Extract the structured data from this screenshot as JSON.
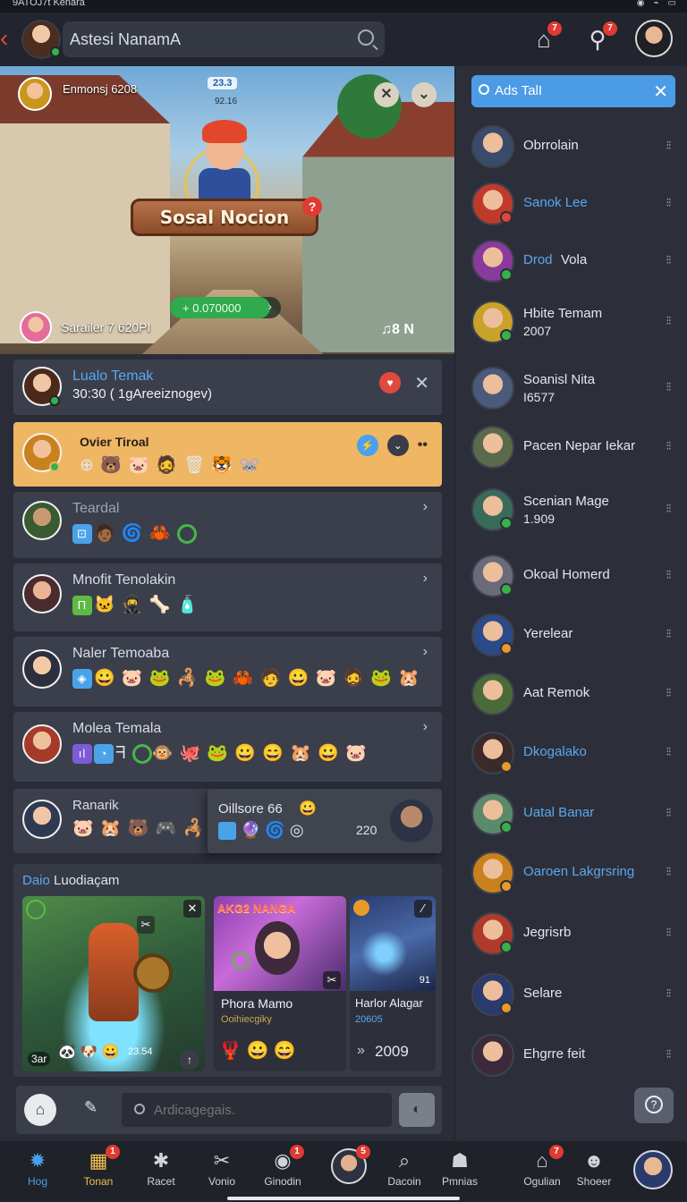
{
  "status_bar": {
    "text": "9ATOJ7t Kenara"
  },
  "header": {
    "search_text": "Astesi NanamA",
    "home_badge": "7",
    "link_badge": "7"
  },
  "hero": {
    "player_name": "Enmonsj 6208",
    "level_chip": "23.3",
    "level_sub": "92.16",
    "sign_title": "Sosal Nocion",
    "sign_badge": "?",
    "progress_text": "+ 0.070000",
    "progress_fraction": 0.9,
    "footer_name": "Sarailer 7 620PI",
    "footer_icons": "♫8  N"
  },
  "conversations": [
    {
      "title": "Lualo Temak",
      "subtitle": "30:30  ( 1gAreeiznogev)"
    },
    {
      "title": "Ovier Tiroal"
    },
    {
      "title": "Teardal"
    },
    {
      "title": "Mnofit Tenolakin"
    },
    {
      "title": "Naler Temoaba"
    },
    {
      "title": "Molea Temala"
    },
    {
      "title": "Ranarik"
    }
  ],
  "popup": {
    "title": "Oillsore 66",
    "number": "220"
  },
  "featured": {
    "title_highlight": "Daio",
    "title_rest": " Luodiaçam",
    "cards": [
      {
        "count": "23.54",
        "footer_left": "3ar"
      },
      {
        "banner": "AKG2 NANGA",
        "name": "Phora Mamo",
        "sub": "Ooihiecgiky",
        "year": ""
      },
      {
        "name": "Harlor Alagar",
        "sub": "20605",
        "year": "2009",
        "badge": "91"
      }
    ]
  },
  "composer": {
    "placeholder": "Ardicagegais."
  },
  "contacts_search": {
    "text": "Ads TalI"
  },
  "contacts": [
    {
      "name": "Obrrolain",
      "sub": "",
      "blue": false,
      "dot": ""
    },
    {
      "name": "Sanok Lee",
      "sub": "",
      "blue": true,
      "dot": "#e0463b"
    },
    {
      "name": "Drod",
      "name2": "Vola",
      "sub": "",
      "blue": true,
      "dot": "#35b24a"
    },
    {
      "name": "Hbite Temam",
      "sub": "2007",
      "blue": false,
      "dot": "#35b24a"
    },
    {
      "name": "Soanisl Nita",
      "sub": "I6577",
      "blue": false,
      "dot": ""
    },
    {
      "name": "Pacen Nepar Iekar",
      "sub": "",
      "blue": false,
      "dot": ""
    },
    {
      "name": "Scenian Mage",
      "sub": "1.909",
      "blue": false,
      "dot": "#35b24a"
    },
    {
      "name": "Okoal Homerd",
      "sub": "",
      "blue": false,
      "dot": "#35b24a"
    },
    {
      "name": "Yerelear",
      "sub": "",
      "blue": false,
      "dot": "#e89a2a"
    },
    {
      "name": "Aat Remok",
      "sub": "",
      "blue": false,
      "dot": ""
    },
    {
      "name": "Dkogalako",
      "sub": "",
      "blue": true,
      "dot": "#e89a2a"
    },
    {
      "name": "Uatal Banar",
      "sub": "",
      "blue": true,
      "dot": "#35b24a"
    },
    {
      "name": "Oaroen Lakgrsring",
      "sub": "",
      "blue": true,
      "dot": "#e89a2a"
    },
    {
      "name": "Jegrisrb",
      "sub": "",
      "blue": false,
      "dot": "#35b24a"
    },
    {
      "name": "Selare",
      "sub": "",
      "blue": false,
      "dot": "#e89a2a"
    },
    {
      "name": "Ehgrre feit",
      "sub": "",
      "blue": false,
      "dot": ""
    }
  ],
  "bottom_nav": [
    {
      "label": "Hog",
      "icon": "gear-icon",
      "badge": ""
    },
    {
      "label": "Tonan",
      "icon": "grid-icon",
      "badge": "1"
    },
    {
      "label": "Racet",
      "icon": "settings-icon",
      "badge": ""
    },
    {
      "label": "Vonio",
      "icon": "tools-icon",
      "badge": ""
    },
    {
      "label": "Ginodin",
      "icon": "chat-icon",
      "badge": "1"
    },
    {
      "label": "",
      "icon": "avatar",
      "badge": "5"
    },
    {
      "label": "Dacoin",
      "icon": "search-icon",
      "badge": ""
    },
    {
      "label": "Pmnias",
      "icon": "people-icon",
      "badge": ""
    },
    {
      "label": "Ogulian",
      "icon": "home-icon",
      "badge": "7"
    },
    {
      "label": "Shoeer",
      "icon": "user-icon",
      "badge": ""
    }
  ],
  "colors": {
    "accent": "#4a9fee",
    "active_row": "#efb764",
    "online": "#35b24a",
    "badge": "#e03a33"
  }
}
